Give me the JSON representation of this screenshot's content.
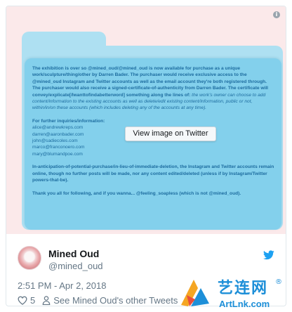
{
  "media": {
    "info_glyph": "i",
    "background_color": "#fbe9ea",
    "folder_color": "#83d0ec",
    "text_color": "#1d6c9f",
    "paragraph1": "The exhibition is over so @mined_oud/@mined_oud is now available for purchase as a unique work/sculpture/thing/other by Darren Bader. The purchaser would receive exclusive access to the @mined_oud Instagram and Twitter accounts as well as the email account they're both registered through. The purchaser would also receive a signed-certificate-of-authenticity from Darren Bader. The certificate will convey/explicate[/Iwanttofindabetterword] something along the lines of:",
    "paragraph1_light": "the work's owner can choose to add content/information to the existing accounts as well as delete/edit existing content/information, public or not, within/in/on these accounts (which includes deleting any of the accounts at any time).",
    "contacts_heading": "For further inquiries/information:",
    "contacts": [
      "alice@andrewkreps.com",
      "darren@aaronbader.com",
      "john@sadiecoles.com",
      "marco@franconoero.com",
      "mary@blumandpoe.com"
    ],
    "paragraph2": "In-anticipation-of-potential-purchase/in-lieu-of-immediate-deletion, the Instagram and Twitter accounts remain online, though no further posts will be made, nor any content edited/deleted (unless if by Instagram/Twitter powers-that-be).",
    "paragraph3": "Thank you all for following, and if you wanna... @feeling_soapless (which is not @mined_oud).",
    "view_button": "View image on Twitter"
  },
  "author": {
    "name": "Mined Oud",
    "handle": "@mined_oud"
  },
  "timestamp": "2:51 PM - Apr 2, 2018",
  "actions": {
    "like_count": "5",
    "other_tweets_label": "See Mined Oud's other Tweets"
  },
  "icons": {
    "bird": "twitter-bird-icon",
    "heart": "heart-icon",
    "person": "person-icon",
    "info": "info-icon"
  },
  "colors": {
    "twitter_blue": "#1da1f2",
    "secondary_text": "#657786"
  },
  "watermark": {
    "chinese": "艺连网",
    "registered": "®",
    "english": "ArtLnk.com"
  }
}
